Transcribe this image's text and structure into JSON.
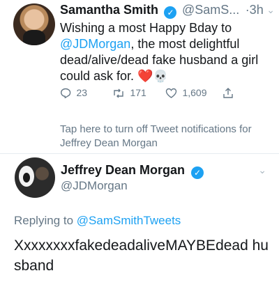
{
  "tweet": {
    "author_name": "Samantha Smith",
    "author_handle": "@SamS...",
    "time": "·3h",
    "text_before": "Wishing a most Happy Bday to ",
    "mention": "@JDMorgan",
    "text_after": ", the most delightful dead/alive/dead fake husband a girl could ask for. ",
    "emoji_heart": "❤️",
    "emoji_skull": "💀",
    "reply_count": "23",
    "retweet_count": "171",
    "like_count": "1,609",
    "notification_text": "Tap here to turn off Tweet notifications for Jeffrey Dean Morgan"
  },
  "reply": {
    "author_name": "Jeffrey Dean Morgan",
    "author_handle": "@JDMorgan",
    "replying_prefix": "Replying to ",
    "replying_handle": "@SamSmithTweets",
    "text": "XxxxxxxxfakedeadaliveMAYBEdead husband"
  },
  "icons": {
    "verified": "verified-badge-icon",
    "chevron": "chevron-down-icon",
    "reply": "reply-icon",
    "retweet": "retweet-icon",
    "like": "heart-icon",
    "share": "share-icon"
  },
  "colors": {
    "accent": "#1da1f2",
    "secondary_text": "#657786",
    "primary_text": "#14171a"
  }
}
